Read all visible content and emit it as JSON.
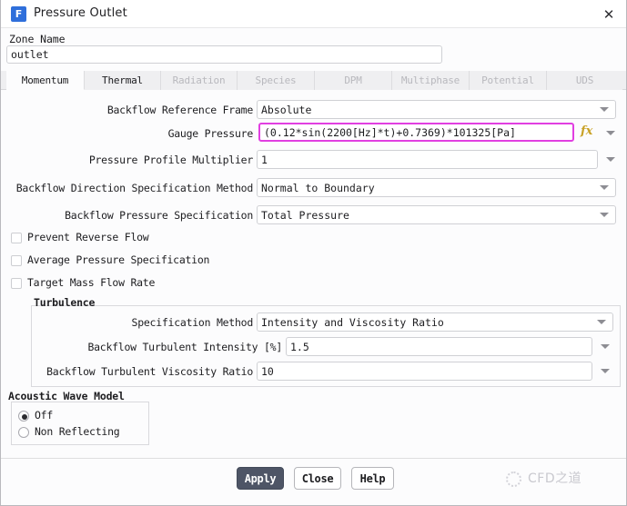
{
  "window": {
    "title": "Pressure Outlet",
    "icon": "fluent-f-icon",
    "close_icon": "✕"
  },
  "zone": {
    "label": "Zone Name",
    "value": "outlet",
    "placeholder": ""
  },
  "tabs": [
    {
      "label": "Momentum",
      "active": true,
      "enabled": true
    },
    {
      "label": "Thermal",
      "active": false,
      "enabled": true
    },
    {
      "label": "Radiation",
      "active": false,
      "enabled": false
    },
    {
      "label": "Species",
      "active": false,
      "enabled": false
    },
    {
      "label": "DPM",
      "active": false,
      "enabled": false
    },
    {
      "label": "Multiphase",
      "active": false,
      "enabled": false
    },
    {
      "label": "Potential",
      "active": false,
      "enabled": false
    },
    {
      "label": "UDS",
      "active": false,
      "enabled": false
    }
  ],
  "momentum": {
    "backflow_reference_frame": {
      "label": "Backflow Reference Frame",
      "value": "Absolute"
    },
    "gauge_pressure": {
      "label": "Gauge Pressure",
      "value": "(0.12*sin(2200[Hz]*t)+0.7369)*101325[Pa]",
      "highlighted": true,
      "fx_icon": "fx"
    },
    "pressure_profile_multiplier": {
      "label": "Pressure Profile Multiplier",
      "value": "1"
    },
    "backflow_direction_spec_method": {
      "label": "Backflow Direction Specification Method",
      "value": "Normal to Boundary"
    },
    "backflow_pressure_spec": {
      "label": "Backflow Pressure Specification",
      "value": "Total Pressure"
    },
    "checkboxes": [
      {
        "label": "Prevent Reverse Flow",
        "checked": false
      },
      {
        "label": "Average Pressure Specification",
        "checked": false
      },
      {
        "label": "Target Mass Flow Rate",
        "checked": false
      }
    ]
  },
  "turbulence": {
    "title": "Turbulence",
    "specification_method": {
      "label": "Specification Method",
      "value": "Intensity and Viscosity Ratio"
    },
    "backflow_turbulent_intensity": {
      "label": "Backflow Turbulent Intensity [%]",
      "value": "1.5"
    },
    "backflow_turbulent_viscosity_ratio": {
      "label": "Backflow Turbulent Viscosity Ratio",
      "value": "10"
    }
  },
  "acoustic_wave_model": {
    "title": "Acoustic Wave Model",
    "options": [
      {
        "label": "Off",
        "selected": true
      },
      {
        "label": "Non Reflecting",
        "selected": false
      }
    ]
  },
  "footer": {
    "apply": "Apply",
    "close": "Close",
    "help": "Help",
    "watermark": "CFD之道"
  },
  "colors": {
    "highlight": "#e13fe1",
    "primary_button": "#4e5566",
    "title_icon": "#2f6fdb",
    "fx": "#c9a227"
  }
}
